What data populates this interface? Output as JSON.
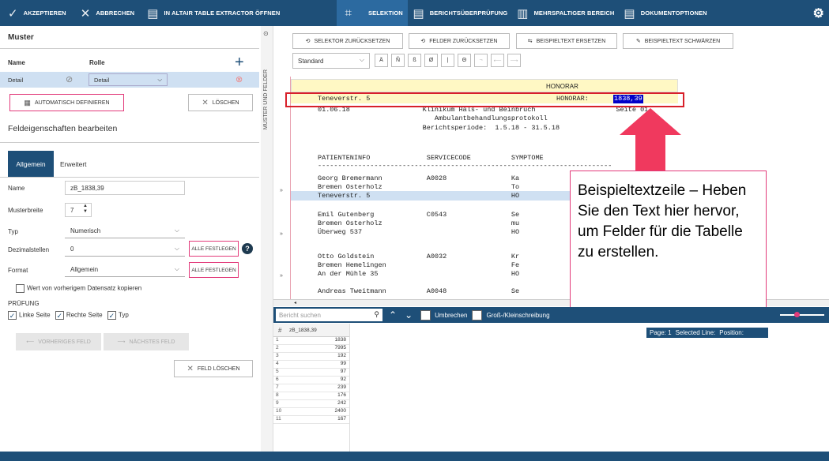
{
  "toolbar": {
    "accept": "AKZEPTIEREN",
    "cancel": "ABBRECHEN",
    "open_tableextractor": "IN ALTAIR TABLE EXTRACTOR ÖFFNEN",
    "selection": "SELEKTION",
    "report_review": "BERICHTSÜBERPRÜFUNG",
    "multicolumn": "MEHRSPALTIGER BEREICH",
    "doc_options": "DOKUMENTOPTIONEN"
  },
  "left": {
    "muster_title": "Muster",
    "col_name": "Name",
    "col_role": "Rolle",
    "row_name": "Detail",
    "row_role": "Detail",
    "auto_define": "AUTOMATISCH DEFINIEREN",
    "delete": "LÖSCHEN",
    "field_props_title": "Feldeigenschaften bearbeiten",
    "tab_general": "Allgemein",
    "tab_extended": "Erweitert",
    "name_label": "Name",
    "name_value": "zB_1838,39",
    "width_label": "Musterbreite",
    "width_value": "7",
    "type_label": "Typ",
    "type_value": "Numerisch",
    "decimals_label": "Dezimalstellen",
    "decimals_value": "0",
    "set_all_1": "ALLE FESTLEGEN",
    "format_label": "Format",
    "format_value": "Allgemein",
    "set_all_2": "ALLE FESTLEGEN",
    "copy_prev": "Wert von vorherigem Datensatz kopieren",
    "check_title": "PRÜFUNG",
    "left_side": "Linke Seite",
    "right_side": "Rechte Seite",
    "type_check": "Typ",
    "prev_field": "VORHERIGES FELD",
    "next_field": "NÄCHSTES FELD",
    "delete_field": "FELD LÖSCHEN"
  },
  "vstrip": "MUSTER UND FELDER",
  "main": {
    "reset_selector": "SELEKTOR ZURÜCKSETZEN",
    "reset_fields": "FELDER ZURÜCKSETZEN",
    "replace_sample": "BEISPIELTEXT ERSETZEN",
    "blacken_sample": "BEISPIELTEXT SCHWÄRZEN",
    "mode": "Standard",
    "chars": [
      "Ä",
      "Ñ",
      "ß",
      "Ø",
      "|",
      "Θ",
      "¬",
      "⟵",
      "⟶"
    ]
  },
  "report": {
    "header_label": "HONORAR",
    "sample_line_left": "Teneverstr. 5",
    "sample_line_mid": "HONORAR:",
    "sample_value": "1838,39",
    "line1": "01.06.18                  Klinikum Hals- und Beinbruch                    Seite 01",
    "line2": "                             Ambulantbehandlungsprotokoll",
    "line3": "                          Berichtsperiode:  1.5.18 - 31.5.18",
    "hdr": "PATIENTENINFO              SERVICECODE          SYMPTOME",
    "dash": "-------------------------------------------------------------------------",
    "r1a": "Georg Bremermann           A0028                Ka",
    "r1b": "Bremen Osterholz                                To",
    "r1c": "Teneverstr. 5                                   HO",
    "r2a": "Emil Gutenberg             C0543                Se",
    "r2b": "Bremen Osterholz                                mu",
    "r2c": "Überweg 537                                     HO",
    "r3a": "Otto Goldstein             A0032                Kr",
    "r3b": "Bremen Hemelingen                               Fe",
    "r3c": "An der Mühle 35                                 HO",
    "r4a": "Andreas Tweitmann          A0048                Se"
  },
  "callout": "Beispieltextzeile – Heben Sie den Text hier hervor, um Felder für die Tabelle zu erstellen.",
  "search": {
    "placeholder": "Bericht suchen",
    "wrap": "Umbrechen",
    "case": "Groß-/Kleinschreibung"
  },
  "status": {
    "page": "Page: 1",
    "selected": "Selected Line:",
    "position": "Position:"
  },
  "grid": {
    "header": "zB_1838,39",
    "rows": [
      {
        "i": "1",
        "v": "1838"
      },
      {
        "i": "2",
        "v": "7995"
      },
      {
        "i": "3",
        "v": "192"
      },
      {
        "i": "4",
        "v": "99"
      },
      {
        "i": "5",
        "v": "97"
      },
      {
        "i": "6",
        "v": "92"
      },
      {
        "i": "7",
        "v": "239"
      },
      {
        "i": "8",
        "v": "176"
      },
      {
        "i": "9",
        "v": "242"
      },
      {
        "i": "10",
        "v": "2400"
      },
      {
        "i": "11",
        "v": "167"
      }
    ]
  },
  "colors": {
    "nav": "#1e4f78",
    "accent": "#e23a7a",
    "highlight": "#0000c8"
  }
}
